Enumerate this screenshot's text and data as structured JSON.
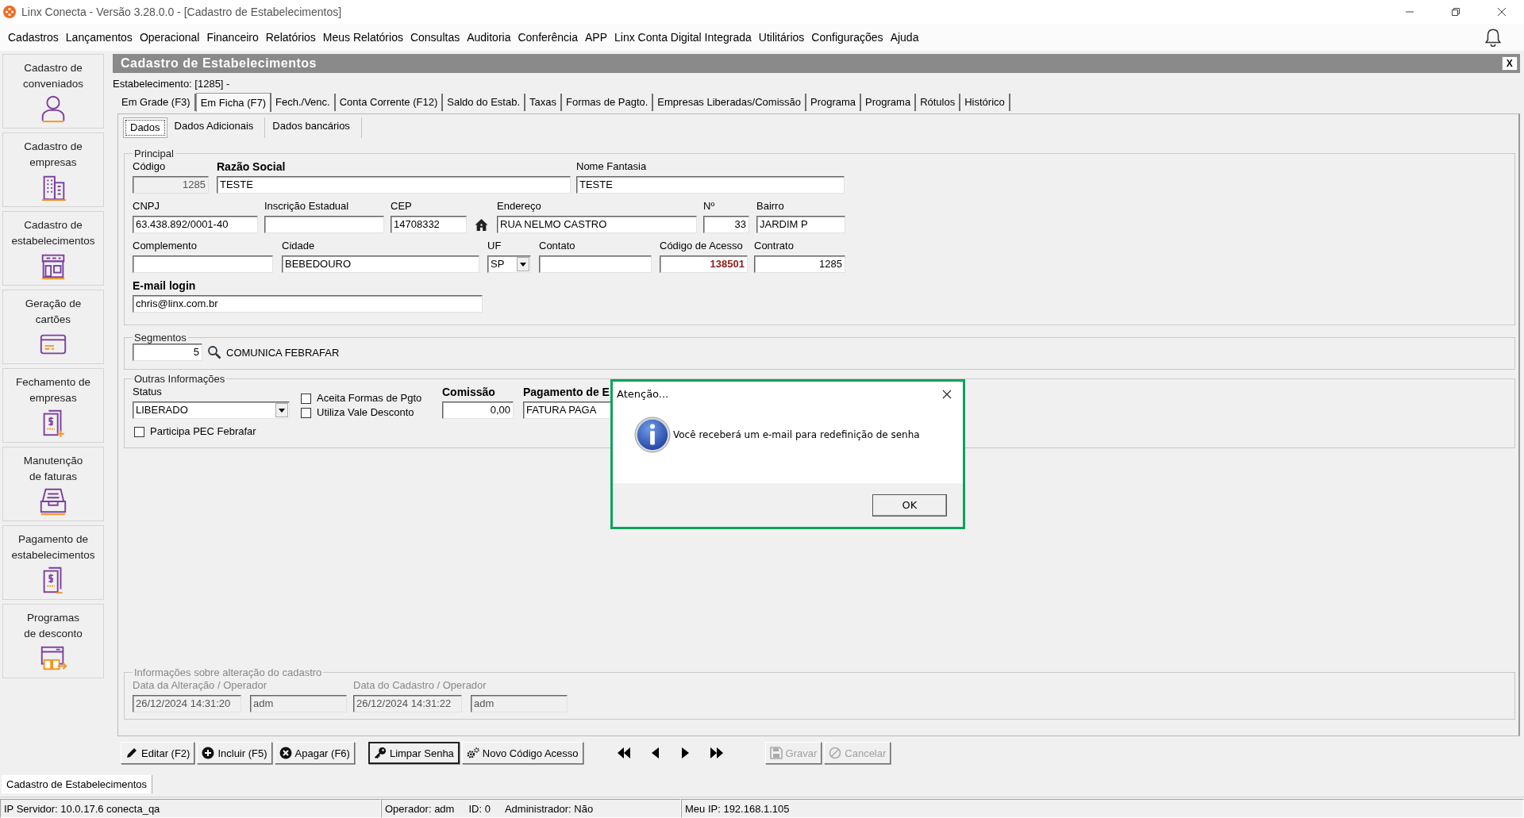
{
  "window": {
    "title": "Linx Conecta - Versão 3.28.0.0 - [Cadastro de Estabelecimentos]"
  },
  "menu": [
    "Cadastros",
    "Lançamentos",
    "Operacional",
    "Financeiro",
    "Relatórios",
    "Meus Relatórios",
    "Consultas",
    "Auditoria",
    "Conferência",
    "APP",
    "Linx Conta Digital Integrada",
    "Utilitários",
    "Configurações",
    "Ajuda"
  ],
  "sidebar": {
    "items": [
      {
        "label": "Cadastro de\nconveniados",
        "kind": "person"
      },
      {
        "label": "Cadastro de\nempresas",
        "kind": "buildings"
      },
      {
        "label": "Cadastro de\nestabelecimentos",
        "kind": "store"
      },
      {
        "label": "Geração de\ncartões",
        "kind": "card"
      },
      {
        "label": "Fechamento de\nempresas",
        "kind": "invoice-add"
      },
      {
        "label": "Manutenção\nde faturas",
        "kind": "tray"
      },
      {
        "label": "Pagamento de\nestabelecimentos",
        "kind": "invoice-pay"
      },
      {
        "label": "Programas\nde desconto",
        "kind": "program"
      }
    ]
  },
  "form": {
    "title": "Cadastro de Estabelecimentos",
    "close": "X",
    "record": "Estabelecimento: [1285] -",
    "tabs": [
      {
        "label": "Em Grade (F3)",
        "selected": false
      },
      {
        "label": "Em Ficha (F7)",
        "selected": true
      },
      {
        "label": "Fech./Venc.",
        "selected": false
      },
      {
        "label": "Conta Corrente (F12)",
        "selected": false
      },
      {
        "label": "Saldo do Estab.",
        "selected": false
      },
      {
        "label": "Taxas",
        "selected": false
      },
      {
        "label": "Formas de Pagto.",
        "selected": false
      },
      {
        "label": "Empresas Liberadas/Comissão",
        "selected": false
      },
      {
        "label": "Programa",
        "selected": false
      },
      {
        "label": "Programa",
        "selected": false
      },
      {
        "label": "Rótulos",
        "selected": false
      },
      {
        "label": "Histórico",
        "selected": false
      }
    ],
    "subtabs": [
      {
        "label": "Dados",
        "selected": true
      },
      {
        "label": "Dados Adicionais",
        "selected": false
      },
      {
        "label": "Dados bancários",
        "selected": false
      }
    ],
    "principal": {
      "title": "Principal",
      "rows": [
        [
          {
            "label": "Código",
            "value": "1285",
            "kind": "text",
            "disabled": true
          },
          {
            "label": "Razão Social",
            "value": "TESTE",
            "kind": "text",
            "bold_label": true
          },
          {
            "label": "Nome Fantasia",
            "value": "TESTE",
            "kind": "text"
          }
        ],
        [
          {
            "label": "CNPJ",
            "value": "63.438.892/0001-40",
            "kind": "text"
          },
          {
            "label": "Inscrição Estadual",
            "kind": "text"
          },
          {
            "label": "CEP",
            "value": "14708332",
            "kind": "text",
            "lookup": true
          },
          {
            "label": "Endereço",
            "value": "RUA NELMO CASTRO",
            "kind": "text"
          },
          {
            "label": "Nº",
            "value": "33",
            "kind": "text"
          },
          {
            "label": "Bairro",
            "value": "JARDIM P",
            "kind": "text"
          }
        ],
        [
          {
            "label": "Complemento",
            "kind": "text"
          },
          {
            "label": "Cidade",
            "value": "BEBEDOURO",
            "kind": "text"
          },
          {
            "label": "UF",
            "value": "SP",
            "kind": "select"
          },
          {
            "label": "Contato",
            "kind": "text"
          },
          {
            "label": "Código de Acesso",
            "value": "138501",
            "kind": "text",
            "highlight": true
          },
          {
            "label": "Contrato",
            "value": "1285",
            "kind": "text"
          }
        ],
        [
          {
            "label": "E-mail login",
            "value": "chris@linx.com.br",
            "kind": "text",
            "bold_label": true
          }
        ]
      ]
    },
    "segmentos": {
      "title": "Segmentos",
      "code": "5",
      "description": "COMUNICA FEBRAFAR"
    },
    "outras": {
      "title": "Outras Informações",
      "status": {
        "label": "Status",
        "value": "LIBERADO"
      },
      "checkboxes": [
        {
          "label": "Aceita Formas de Pgto",
          "checked": false
        },
        {
          "label": "Utiliza Vale Desconto",
          "checked": false
        }
      ],
      "comissao": {
        "label": "Comissão",
        "value": "0,00"
      },
      "pagamento": {
        "label": "Pagamento de E",
        "value": "FATURA PAGA"
      },
      "pec": {
        "label": "Participa PEC Febrafar",
        "checked": false
      }
    },
    "alteracao": {
      "title": "Informações sobre alteração do cadastro",
      "groups": [
        {
          "label": "Data da Alteração / Operador",
          "date": "26/12/2024 14:31:20",
          "operator": "adm"
        },
        {
          "label": "Data do Cadastro / Operador",
          "date": "26/12/2024 14:31:22",
          "operator": "adm"
        }
      ]
    },
    "toolbar": [
      {
        "label": "Editar (F2)",
        "kind": "edit",
        "disabled": false,
        "focused": false
      },
      {
        "label": "Incluir (F5)",
        "kind": "add",
        "disabled": false,
        "focused": false
      },
      {
        "label": "Apagar (F6)",
        "kind": "delete",
        "disabled": false,
        "focused": false
      },
      {
        "label": "Limpar Senha",
        "kind": "key",
        "disabled": false,
        "focused": true
      },
      {
        "label": "Novo Código Acesso",
        "kind": "gears",
        "disabled": false,
        "focused": false
      },
      {
        "kind": "first"
      },
      {
        "kind": "prev"
      },
      {
        "kind": "next"
      },
      {
        "kind": "last"
      },
      {
        "label": "Gravar",
        "kind": "save",
        "disabled": true,
        "focused": false
      },
      {
        "label": "Cancelar",
        "kind": "cancel",
        "disabled": true,
        "focused": false
      }
    ]
  },
  "dialog": {
    "title": "Atenção...",
    "message": "Você receberá um e-mail para redefinição de senha",
    "button": "OK"
  },
  "window_tabs": [
    {
      "label": "Cadastro de Estabelecimentos",
      "selected": true
    }
  ],
  "status_bar": [
    {
      "items": [
        "IP Servidor: 10.0.17.6 conecta_qa"
      ]
    },
    {
      "items": [
        "Operador: adm",
        "ID: 0",
        "Administrador: Não"
      ]
    },
    {
      "items": [
        "Meu IP: 192.168.1.105"
      ]
    }
  ]
}
